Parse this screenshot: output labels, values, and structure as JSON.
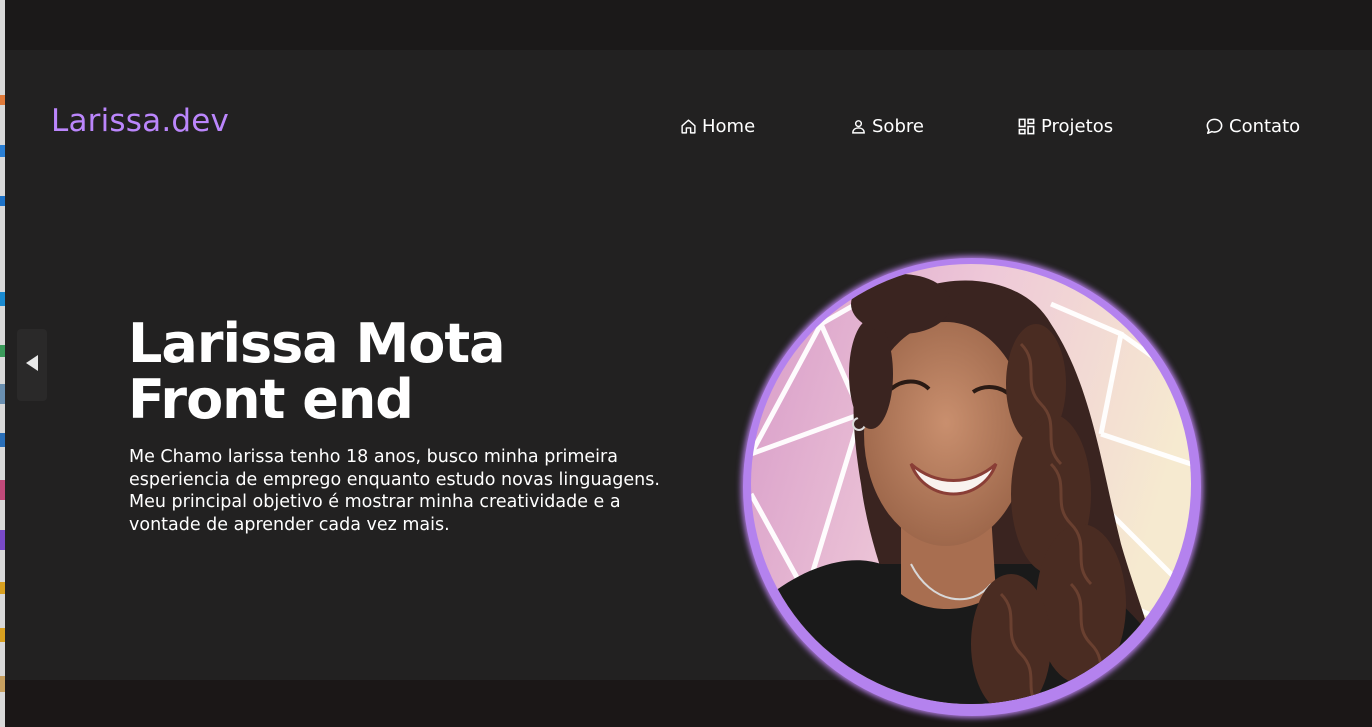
{
  "brand": {
    "logo_text": "Larissa.dev",
    "accent_color": "#bb86fc"
  },
  "nav": {
    "items": [
      {
        "label": "Home",
        "icon": "home-icon"
      },
      {
        "label": "Sobre",
        "icon": "user-icon"
      },
      {
        "label": "Projetos",
        "icon": "grid-icon"
      },
      {
        "label": "Contato",
        "icon": "chat-bubble-icon"
      }
    ]
  },
  "hero": {
    "title_line1": "Larissa Mota",
    "title_line2": "Front end",
    "description_lines": [
      "Me Chamo larissa tenho 18 anos, busco minha primeira",
      "esperiencia de emprego enquanto estudo novas linguagens.",
      "Meu principal objetivo é mostrar minha creatividade e a",
      "vontade de aprender cada vez mais."
    ]
  },
  "controls": {
    "side_arrow_icon": "triangle-left-icon"
  },
  "colors": {
    "background": "#222121",
    "text": "#ffffff",
    "avatar_ring": "#b482ee"
  }
}
